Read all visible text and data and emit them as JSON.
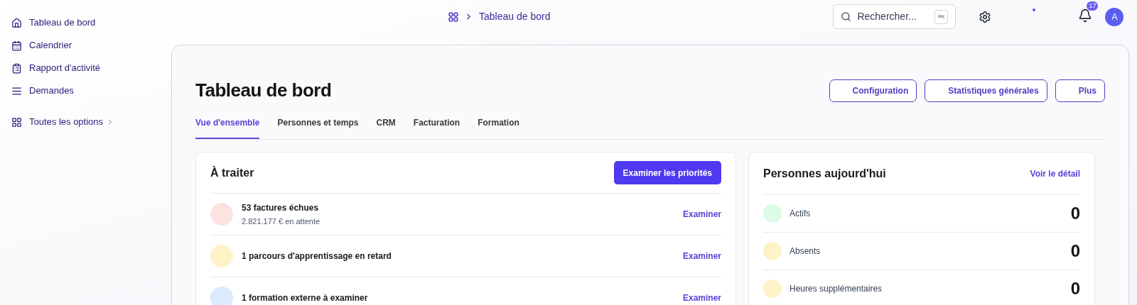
{
  "sidebar": {
    "items": [
      {
        "label": "Tableau de bord"
      },
      {
        "label": "Calendrier"
      },
      {
        "label": "Rapport d'activité"
      },
      {
        "label": "Demandes"
      }
    ],
    "all_options": "Toutes les options"
  },
  "header": {
    "breadcrumb": "Tableau de bord",
    "search": {
      "placeholder": "Rechercher...",
      "shortcut": "⌘K"
    },
    "notifications": "17",
    "avatar": "A"
  },
  "page": {
    "title": "Tableau de bord",
    "actions": [
      "Configuration",
      "Statistiques générales",
      "Plus"
    ],
    "tabs": [
      {
        "label": "Vue d'ensemble",
        "selected": true
      },
      {
        "label": "Personnes et temps",
        "selected": false
      },
      {
        "label": "CRM",
        "selected": false
      },
      {
        "label": "Facturation",
        "selected": false
      },
      {
        "label": "Formation",
        "selected": false
      }
    ]
  },
  "todo": {
    "title": "À traiter",
    "button": "Examiner les priorités",
    "items": [
      {
        "title": "53 factures échues",
        "subtitle": "2.821.177 € en attente",
        "action": "Examiner",
        "color": "#fde2e2"
      },
      {
        "title": "1 parcours d'apprentissage en retard",
        "action": "Examiner",
        "color": "#fef3c7"
      },
      {
        "title": "1 formation externe à examiner",
        "action": "Examiner",
        "color": "#dbeafe"
      }
    ]
  },
  "people": {
    "title": "Personnes aujourd'hui",
    "link": "Voir le détail",
    "items": [
      {
        "label": "Actifs",
        "value": "0",
        "color": "#dcfce7"
      },
      {
        "label": "Absents",
        "value": "0",
        "color": "#fef3c7"
      },
      {
        "label": "Heures supplémentaires",
        "value": "0",
        "color": "#fef3c7"
      }
    ]
  }
}
